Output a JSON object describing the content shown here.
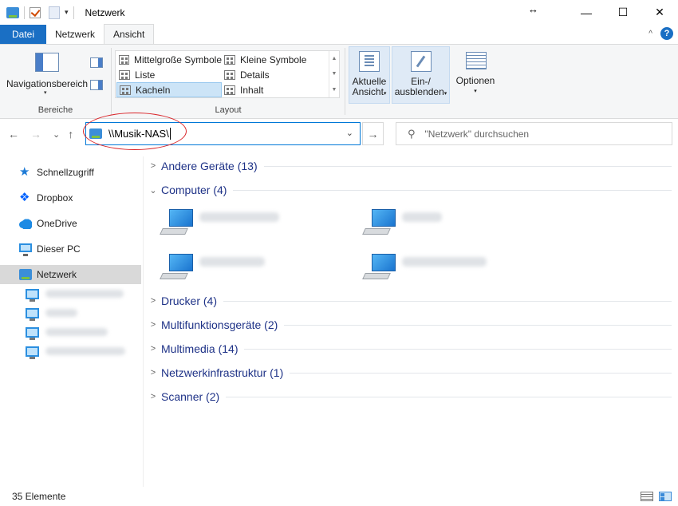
{
  "window": {
    "title": "Netzwerk",
    "controls": [
      "—",
      "☐",
      "✕"
    ],
    "resize_glyph": "↔"
  },
  "quick_access": {
    "dropdown_glyph": "▾"
  },
  "ribbon_tabs": [
    {
      "label": "Datei"
    },
    {
      "label": "Netzwerk"
    },
    {
      "label": "Ansicht"
    }
  ],
  "ribbon": {
    "collapse_glyph": "^",
    "help_glyph": "?",
    "bereiche": {
      "navigationsbereich": "Navigationsbereich",
      "label": "Bereiche"
    },
    "layout": {
      "label": "Layout",
      "items": [
        "Mittelgroße Symbole",
        "Kleine Symbole",
        "Liste",
        "Details",
        "Kacheln",
        "Inhalt"
      ],
      "selected": "Kacheln"
    },
    "aktuelle_ansicht": {
      "line1": "Aktuelle",
      "line2": "Ansicht"
    },
    "ein_ausblenden": {
      "line1": "Ein-/",
      "line2": "ausblenden"
    },
    "optionen": "Optionen",
    "dd_glyph": "▾"
  },
  "nav": {
    "back": "←",
    "forward": "→",
    "recent": "⌄",
    "up": "↑"
  },
  "address": {
    "value": "\\\\Musik-NAS\\",
    "dropdown_glyph": "⌄",
    "go_glyph": "→"
  },
  "search": {
    "placeholder": "\"Netzwerk\" durchsuchen",
    "icon_glyph": "⚲"
  },
  "sidebar": {
    "items": [
      {
        "label": "Schnellzugriff",
        "icon": "star-icon"
      },
      {
        "label": "Dropbox",
        "icon": "dropbox-icon"
      },
      {
        "label": "OneDrive",
        "icon": "onedrive-icon"
      },
      {
        "label": "Dieser PC",
        "icon": "pc-icon"
      },
      {
        "label": "Netzwerk",
        "icon": "network-icon",
        "selected": true
      }
    ]
  },
  "groups": [
    {
      "title": "Andere Geräte (13)",
      "expanded": false
    },
    {
      "title": "Computer (4)",
      "expanded": true
    },
    {
      "title": "Drucker (4)",
      "expanded": false
    },
    {
      "title": "Multifunktionsgeräte (2)",
      "expanded": false
    },
    {
      "title": "Multimedia (14)",
      "expanded": false
    },
    {
      "title": "Netzwerkinfrastruktur (1)",
      "expanded": false
    },
    {
      "title": "Scanner (2)",
      "expanded": false
    }
  ],
  "status": {
    "count": "35 Elemente"
  },
  "colors": {
    "accent": "#1a6fc4",
    "group_title": "#1e3287",
    "annotation_ellipse": "#d9262b",
    "selected_bg": "#cce4f7"
  }
}
